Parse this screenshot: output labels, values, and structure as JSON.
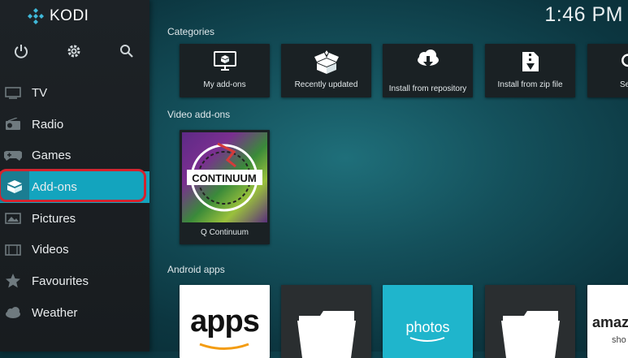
{
  "app": {
    "logo_text": "KODI",
    "clock": "1:46 PM"
  },
  "topbar": {
    "icons": [
      "power-icon",
      "settings-icon",
      "search-icon"
    ]
  },
  "sidebar": {
    "items": [
      {
        "label": "TV",
        "icon": "tv-icon",
        "active": false
      },
      {
        "label": "Radio",
        "icon": "radio-icon",
        "active": false
      },
      {
        "label": "Games",
        "icon": "gamepad-icon",
        "active": false
      },
      {
        "label": "Add-ons",
        "icon": "addon-box-icon",
        "active": true
      },
      {
        "label": "Pictures",
        "icon": "picture-icon",
        "active": false
      },
      {
        "label": "Videos",
        "icon": "film-icon",
        "active": false
      },
      {
        "label": "Favourites",
        "icon": "star-icon",
        "active": false
      },
      {
        "label": "Weather",
        "icon": "weather-icon",
        "active": false
      }
    ]
  },
  "sections": {
    "categories": {
      "title": "Categories",
      "tiles": [
        {
          "label": "My add-ons",
          "icon": "monitor-box-icon"
        },
        {
          "label": "Recently updated",
          "icon": "open-box-icon"
        },
        {
          "label": "Install from repository",
          "icon": "cloud-download-icon"
        },
        {
          "label": "Install from zip file",
          "icon": "zip-file-icon"
        },
        {
          "label": "Se",
          "icon": "search-icon"
        }
      ]
    },
    "video_addons": {
      "title": "Video add-ons",
      "tiles": [
        {
          "label": "Q Continuum",
          "art_text": "CONTINUUM"
        }
      ]
    },
    "android_apps": {
      "title": "Android apps",
      "tiles": [
        {
          "art_text": "apps"
        },
        {
          "icon": "folder-icon"
        },
        {
          "art_text": "photos"
        },
        {
          "icon": "folder-icon"
        },
        {
          "art_text": "amaz",
          "art_subtext": "sho"
        }
      ]
    }
  },
  "colors": {
    "accent": "#13a4be",
    "highlight_ring": "#d4232e",
    "sidebar_bg": "#1d2226",
    "tile_bg": "#1a2124"
  }
}
